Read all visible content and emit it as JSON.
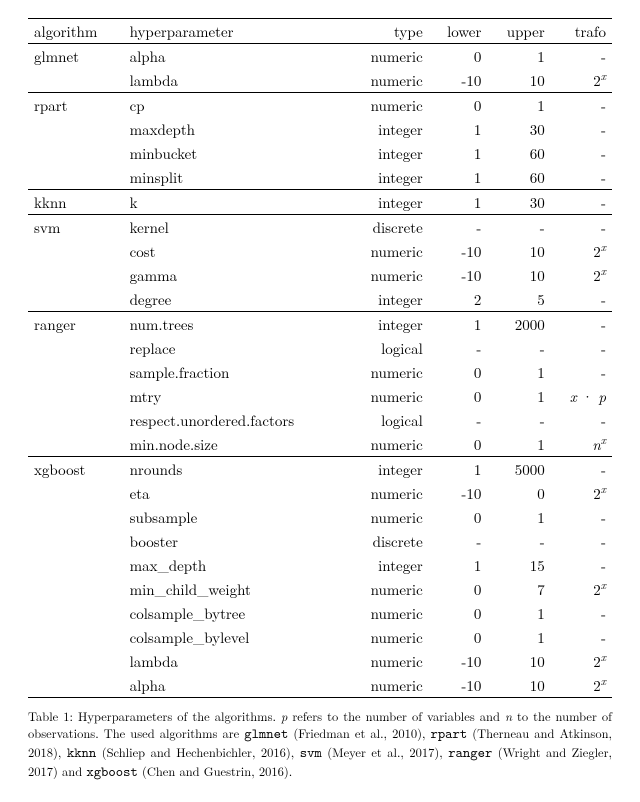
{
  "chart_data": {
    "type": "table",
    "title": "Table 1: Hyperparameters of the algorithms.",
    "columns": [
      "algorithm",
      "hyperparameter",
      "type",
      "lower",
      "upper",
      "trafo"
    ],
    "rows": [
      {
        "algorithm": "glmnet",
        "hyperparameter": "alpha",
        "type": "numeric",
        "lower": "0",
        "upper": "1",
        "trafo": "-",
        "group_start": true
      },
      {
        "algorithm": "",
        "hyperparameter": "lambda",
        "type": "numeric",
        "lower": "-10",
        "upper": "10",
        "trafo": "2^x"
      },
      {
        "algorithm": "rpart",
        "hyperparameter": "cp",
        "type": "numeric",
        "lower": "0",
        "upper": "1",
        "trafo": "-",
        "group_start": true
      },
      {
        "algorithm": "",
        "hyperparameter": "maxdepth",
        "type": "integer",
        "lower": "1",
        "upper": "30",
        "trafo": "-"
      },
      {
        "algorithm": "",
        "hyperparameter": "minbucket",
        "type": "integer",
        "lower": "1",
        "upper": "60",
        "trafo": "-"
      },
      {
        "algorithm": "",
        "hyperparameter": "minsplit",
        "type": "integer",
        "lower": "1",
        "upper": "60",
        "trafo": "-"
      },
      {
        "algorithm": "kknn",
        "hyperparameter": "k",
        "type": "integer",
        "lower": "1",
        "upper": "30",
        "trafo": "-",
        "group_start": true
      },
      {
        "algorithm": "svm",
        "hyperparameter": "kernel",
        "type": "discrete",
        "lower": "-",
        "upper": "-",
        "trafo": "-",
        "group_start": true
      },
      {
        "algorithm": "",
        "hyperparameter": "cost",
        "type": "numeric",
        "lower": "-10",
        "upper": "10",
        "trafo": "2^x"
      },
      {
        "algorithm": "",
        "hyperparameter": "gamma",
        "type": "numeric",
        "lower": "-10",
        "upper": "10",
        "trafo": "2^x"
      },
      {
        "algorithm": "",
        "hyperparameter": "degree",
        "type": "integer",
        "lower": "2",
        "upper": "5",
        "trafo": "-"
      },
      {
        "algorithm": "ranger",
        "hyperparameter": "num.trees",
        "type": "integer",
        "lower": "1",
        "upper": "2000",
        "trafo": "-",
        "group_start": true
      },
      {
        "algorithm": "",
        "hyperparameter": "replace",
        "type": "logical",
        "lower": "-",
        "upper": "-",
        "trafo": "-"
      },
      {
        "algorithm": "",
        "hyperparameter": "sample.fraction",
        "type": "numeric",
        "lower": "0",
        "upper": "1",
        "trafo": "-"
      },
      {
        "algorithm": "",
        "hyperparameter": "mtry",
        "type": "numeric",
        "lower": "0",
        "upper": "1",
        "trafo": "x·p"
      },
      {
        "algorithm": "",
        "hyperparameter": "respect.unordered.factors",
        "type": "logical",
        "lower": "-",
        "upper": "-",
        "trafo": "-"
      },
      {
        "algorithm": "",
        "hyperparameter": "min.node.size",
        "type": "numeric",
        "lower": "0",
        "upper": "1",
        "trafo": "n^x"
      },
      {
        "algorithm": "xgboost",
        "hyperparameter": "nrounds",
        "type": "integer",
        "lower": "1",
        "upper": "5000",
        "trafo": "-",
        "group_start": true
      },
      {
        "algorithm": "",
        "hyperparameter": "eta",
        "type": "numeric",
        "lower": "-10",
        "upper": "0",
        "trafo": "2^x"
      },
      {
        "algorithm": "",
        "hyperparameter": "subsample",
        "type": "numeric",
        "lower": "0",
        "upper": "1",
        "trafo": "-"
      },
      {
        "algorithm": "",
        "hyperparameter": "booster",
        "type": "discrete",
        "lower": "-",
        "upper": "-",
        "trafo": "-"
      },
      {
        "algorithm": "",
        "hyperparameter": "max_depth",
        "type": "integer",
        "lower": "1",
        "upper": "15",
        "trafo": "-"
      },
      {
        "algorithm": "",
        "hyperparameter": "min_child_weight",
        "type": "numeric",
        "lower": "0",
        "upper": "7",
        "trafo": "2^x"
      },
      {
        "algorithm": "",
        "hyperparameter": "colsample_bytree",
        "type": "numeric",
        "lower": "0",
        "upper": "1",
        "trafo": "-"
      },
      {
        "algorithm": "",
        "hyperparameter": "colsample_bylevel",
        "type": "numeric",
        "lower": "0",
        "upper": "1",
        "trafo": "-"
      },
      {
        "algorithm": "",
        "hyperparameter": "lambda",
        "type": "numeric",
        "lower": "-10",
        "upper": "10",
        "trafo": "2^x"
      },
      {
        "algorithm": "",
        "hyperparameter": "alpha",
        "type": "numeric",
        "lower": "-10",
        "upper": "10",
        "trafo": "2^x"
      }
    ]
  },
  "caption": {
    "prefix": "Table 1: Hyperparameters of the algorithms. ",
    "body1": " refers to the number of variables and ",
    "body2": " to the number of observations. The used algorithms are ",
    "glmnet": "glmnet",
    "glmnet_cite": " (Friedman et al., 2010), ",
    "rpart": "rpart",
    "rpart_cite": " (Therneau and Atkinson, 2018), ",
    "kknn": "kknn",
    "kknn_cite": " (Schliep and Hechenbichler, 2016), ",
    "svm": "svm",
    "svm_cite": " (Meyer et al., 2017), ",
    "ranger": "ranger",
    "ranger_cite": " (Wright and Ziegler, 2017) and ",
    "xgboost": "xgboost",
    "xgboost_cite": " (Chen and Guestrin, 2016).",
    "p": "p",
    "n": "n"
  }
}
